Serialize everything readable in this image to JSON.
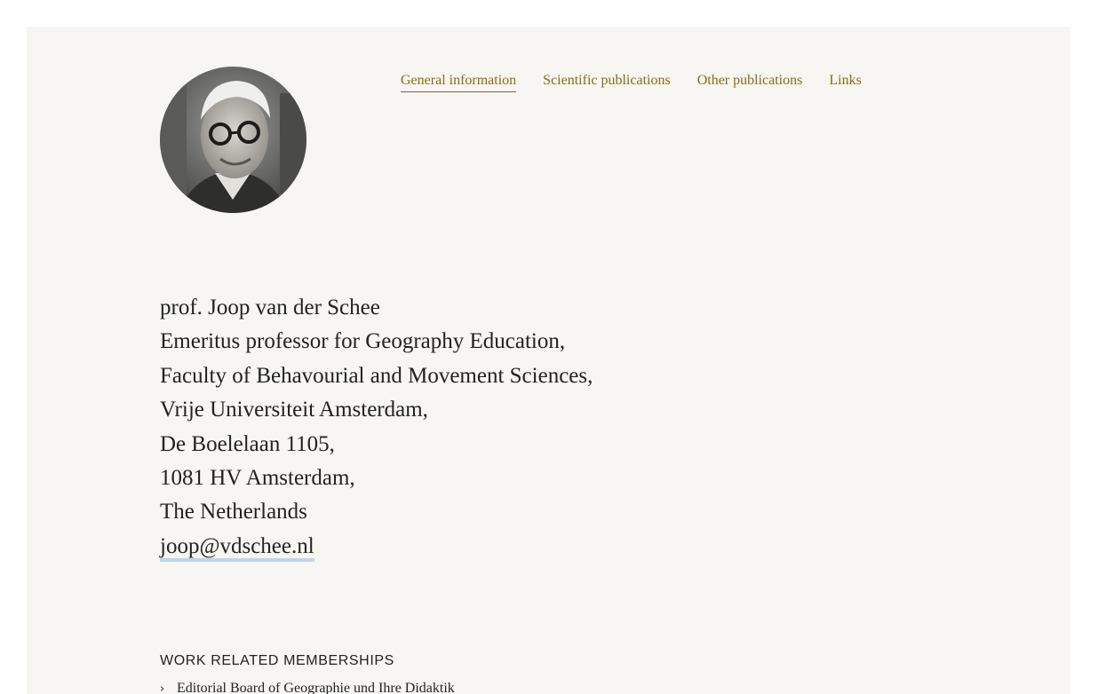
{
  "nav": {
    "items": [
      {
        "label": "General information",
        "active": true
      },
      {
        "label": "Scientific publications",
        "active": false
      },
      {
        "label": "Other publications",
        "active": false
      },
      {
        "label": "Links",
        "active": false
      }
    ]
  },
  "profile": {
    "avatar_icon": "portrait-photo",
    "lines": [
      "prof. Joop van der Schee",
      "Emeritus professor for Geography Education,",
      "Faculty of Behavourial and Movement Sciences,",
      "Vrije Universiteit Amsterdam,",
      "De Boelelaan 1105,",
      "1081 HV Amsterdam,",
      "The Netherlands"
    ],
    "email": "joop@vdschee.nl"
  },
  "memberships": {
    "heading": "WORK RELATED MEMBERSHIPS",
    "items": [
      "Editorial Board of Geographie und Ihre Didaktik"
    ]
  },
  "colors": {
    "background": "#f7f6f2",
    "link": "#8c6a12",
    "text": "#222222",
    "email_underline": "#bcd6ea"
  }
}
